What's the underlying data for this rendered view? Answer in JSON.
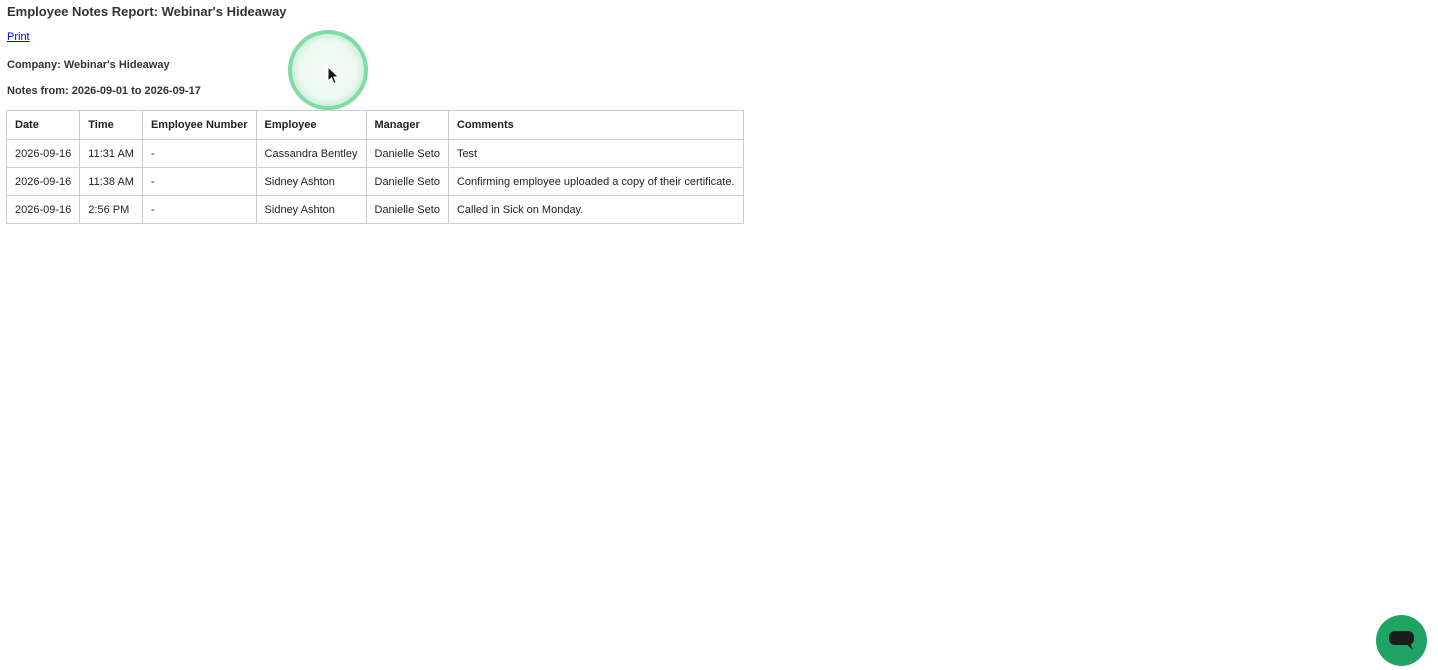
{
  "report": {
    "title": "Employee Notes Report: Webinar's Hideaway",
    "print_label": "Print",
    "company_label": "Company: Webinar's Hideaway",
    "range_label": "Notes from: 2026-09-01 to 2026-09-17"
  },
  "table": {
    "headers": [
      "Date",
      "Time",
      "Employee Number",
      "Employee",
      "Manager",
      "Comments"
    ],
    "rows": [
      [
        "2026-09-16",
        "11:31 AM",
        "-",
        "Cassandra Bentley",
        "Danielle Seto",
        "Test"
      ],
      [
        "2026-09-16",
        "11:38 AM",
        "-",
        "Sidney Ashton",
        "Danielle Seto",
        "Confirming employee uploaded a copy of their certificate."
      ],
      [
        "2026-09-16",
        "2:56 PM",
        "-",
        "Sidney Ashton",
        "Danielle Seto",
        "Called in Sick on Monday."
      ]
    ]
  },
  "chat": {
    "icon": "chat-icon",
    "color": "#21a365"
  }
}
